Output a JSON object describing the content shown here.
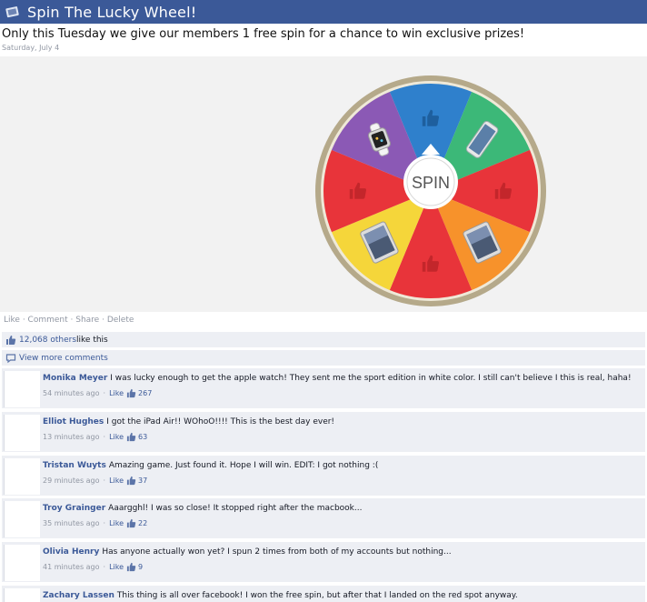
{
  "header": {
    "title": "Spin The Lucky Wheel!"
  },
  "post": {
    "text": "Only this Tuesday we give our members 1 free spin for a chance to win exclusive prizes!",
    "date": "Saturday, July 4"
  },
  "wheel": {
    "center_label": "SPIN",
    "segments": [
      {
        "color": "#2f80cc",
        "icon": "thumbs-up-icon"
      },
      {
        "color": "#3cb878",
        "icon": "phone-icon"
      },
      {
        "color": "#e8343a",
        "icon": "thumbs-up-icon"
      },
      {
        "color": "#f7922b",
        "icon": "tablet-icon"
      },
      {
        "color": "#e8343a",
        "icon": "thumbs-up-icon"
      },
      {
        "color": "#f5d63a",
        "icon": "tablet-icon"
      },
      {
        "color": "#e8343a",
        "icon": "thumbs-up-icon"
      },
      {
        "color": "#8b59b5",
        "icon": "watch-icon"
      }
    ]
  },
  "actions": {
    "like": "Like",
    "comment": "Comment",
    "share": "Share",
    "delete": "Delete",
    "sep": " · "
  },
  "likes": {
    "count_text": "12,068 others",
    "suffix": " like this"
  },
  "more_comments": "View more comments",
  "like_label": "Like",
  "comments": [
    {
      "name": "Monika Meyer",
      "text": "I was lucky enough to get the apple watch! They sent me the sport edition in white color. I still can't believe I this is real, haha!",
      "time": "54 minutes ago",
      "likes": "267"
    },
    {
      "name": "Elliot Hughes",
      "text": "I got the iPad Air!! WOhoO!!!! This is the best day ever!",
      "time": "13 minutes ago",
      "likes": "63"
    },
    {
      "name": "Tristan Wuyts",
      "text": "Amazing game. Just found it. Hope I will win. EDIT: I got nothing :(",
      "time": "29 minutes ago",
      "likes": "37"
    },
    {
      "name": "Troy Grainger",
      "text": "Aaargghl! I was so close! It stopped right after the macbook...",
      "time": "35 minutes ago",
      "likes": "22"
    },
    {
      "name": "Olivia Henry",
      "text": "Has anyone actually won yet? I spun 2 times from both of my accounts but nothing...",
      "time": "41 minutes ago",
      "likes": "9"
    },
    {
      "name": "Zachary Lassen",
      "text": "This thing is all over facebook! I won the free spin, but after that I landed on the red spot anyway.",
      "time": "",
      "likes": ""
    }
  ],
  "colors": {
    "brand": "#3b5998",
    "bar_bg": "#edeff4",
    "wheel_rim": "#b5a98a"
  }
}
